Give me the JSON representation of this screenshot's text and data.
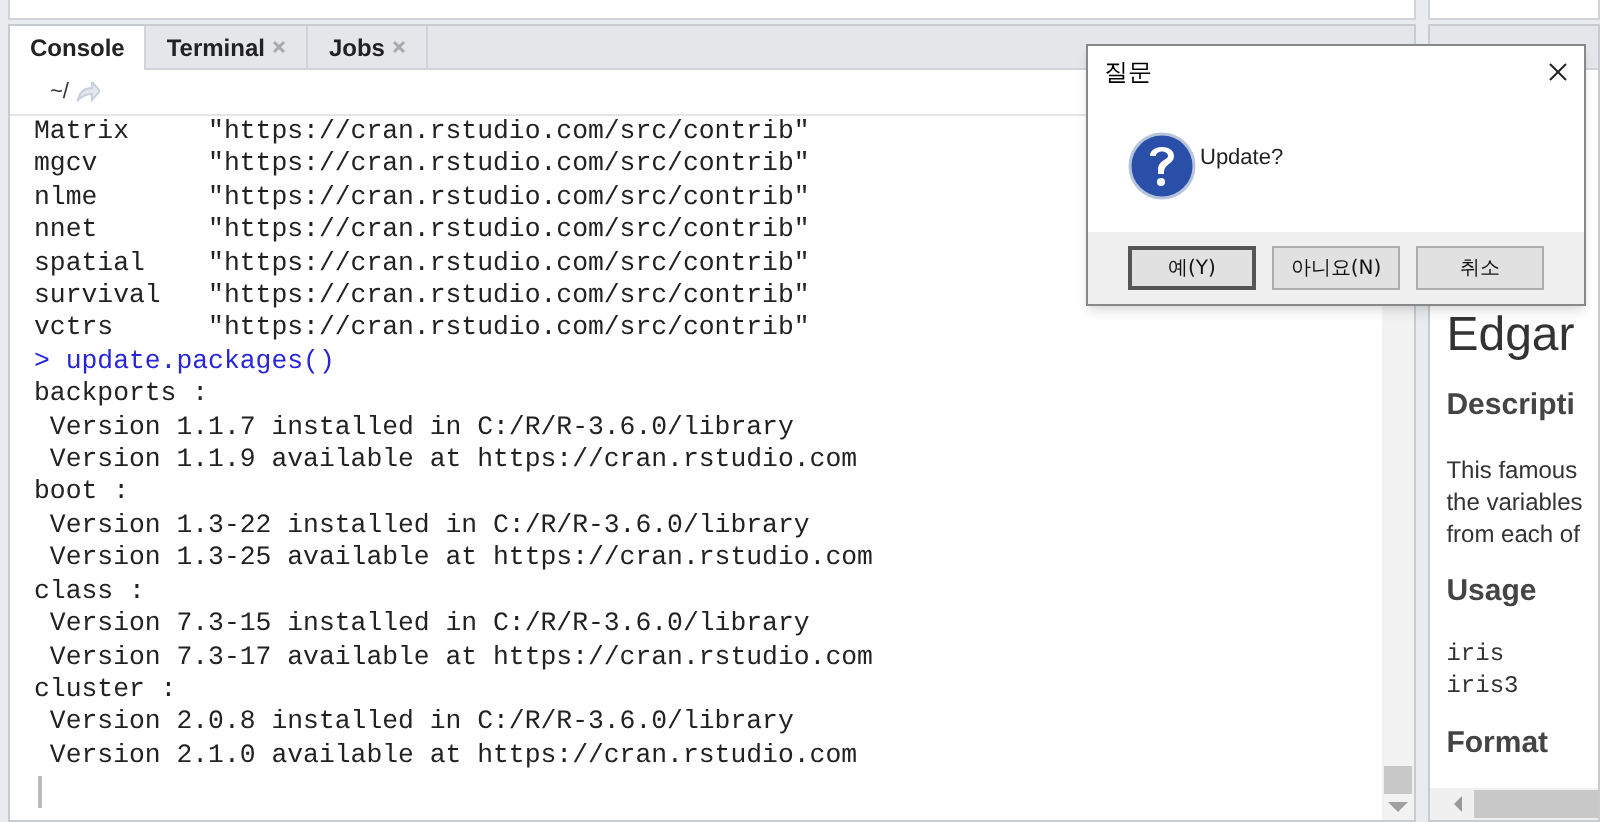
{
  "console": {
    "tabs": [
      {
        "label": "Console",
        "selected": true,
        "closable": false
      },
      {
        "label": "Terminal",
        "selected": false,
        "closable": true
      },
      {
        "label": "Jobs",
        "selected": false,
        "closable": true
      }
    ],
    "path": "~/",
    "lines": [
      {
        "kind": "output",
        "text": "Matrix     \"https://cran.rstudio.com/src/contrib\""
      },
      {
        "kind": "output",
        "text": "mgcv       \"https://cran.rstudio.com/src/contrib\""
      },
      {
        "kind": "output",
        "text": "nlme       \"https://cran.rstudio.com/src/contrib\""
      },
      {
        "kind": "output",
        "text": "nnet       \"https://cran.rstudio.com/src/contrib\""
      },
      {
        "kind": "output",
        "text": "spatial    \"https://cran.rstudio.com/src/contrib\""
      },
      {
        "kind": "output",
        "text": "survival   \"https://cran.rstudio.com/src/contrib\""
      },
      {
        "kind": "output",
        "text": "vctrs      \"https://cran.rstudio.com/src/contrib\""
      },
      {
        "kind": "command",
        "text": "> update.packages()"
      },
      {
        "kind": "output",
        "text": "backports :"
      },
      {
        "kind": "output",
        "text": " Version 1.1.7 installed in C:/R/R-3.6.0/library"
      },
      {
        "kind": "output",
        "text": " Version 1.1.9 available at https://cran.rstudio.com"
      },
      {
        "kind": "output",
        "text": "boot :"
      },
      {
        "kind": "output",
        "text": " Version 1.3-22 installed in C:/R/R-3.6.0/library"
      },
      {
        "kind": "output",
        "text": " Version 1.3-25 available at https://cran.rstudio.com"
      },
      {
        "kind": "output",
        "text": "class :"
      },
      {
        "kind": "output",
        "text": " Version 7.3-15 installed in C:/R/R-3.6.0/library"
      },
      {
        "kind": "output",
        "text": " Version 7.3-17 available at https://cran.rstudio.com"
      },
      {
        "kind": "output",
        "text": "cluster :"
      },
      {
        "kind": "output",
        "text": " Version 2.0.8 installed in C:/R/R-3.6.0/library"
      },
      {
        "kind": "output",
        "text": " Version 2.1.0 available at https://cran.rstudio.com"
      }
    ]
  },
  "help_pane": {
    "title": "Edgar",
    "sections": [
      {
        "kind": "heading",
        "text": "Descripti"
      },
      {
        "kind": "paragraph",
        "lines": [
          "This famous",
          "the variables",
          "from each of"
        ]
      },
      {
        "kind": "heading",
        "text": "Usage"
      },
      {
        "kind": "code",
        "lines": [
          "iris",
          "iris3"
        ]
      },
      {
        "kind": "heading",
        "text": "Format"
      }
    ]
  },
  "dialog": {
    "title": "질문",
    "message": "Update?",
    "buttons": [
      {
        "label": "예(Y)",
        "selected": true
      },
      {
        "label": "아니요(N)",
        "selected": false
      },
      {
        "label": "취소",
        "selected": false
      }
    ]
  }
}
